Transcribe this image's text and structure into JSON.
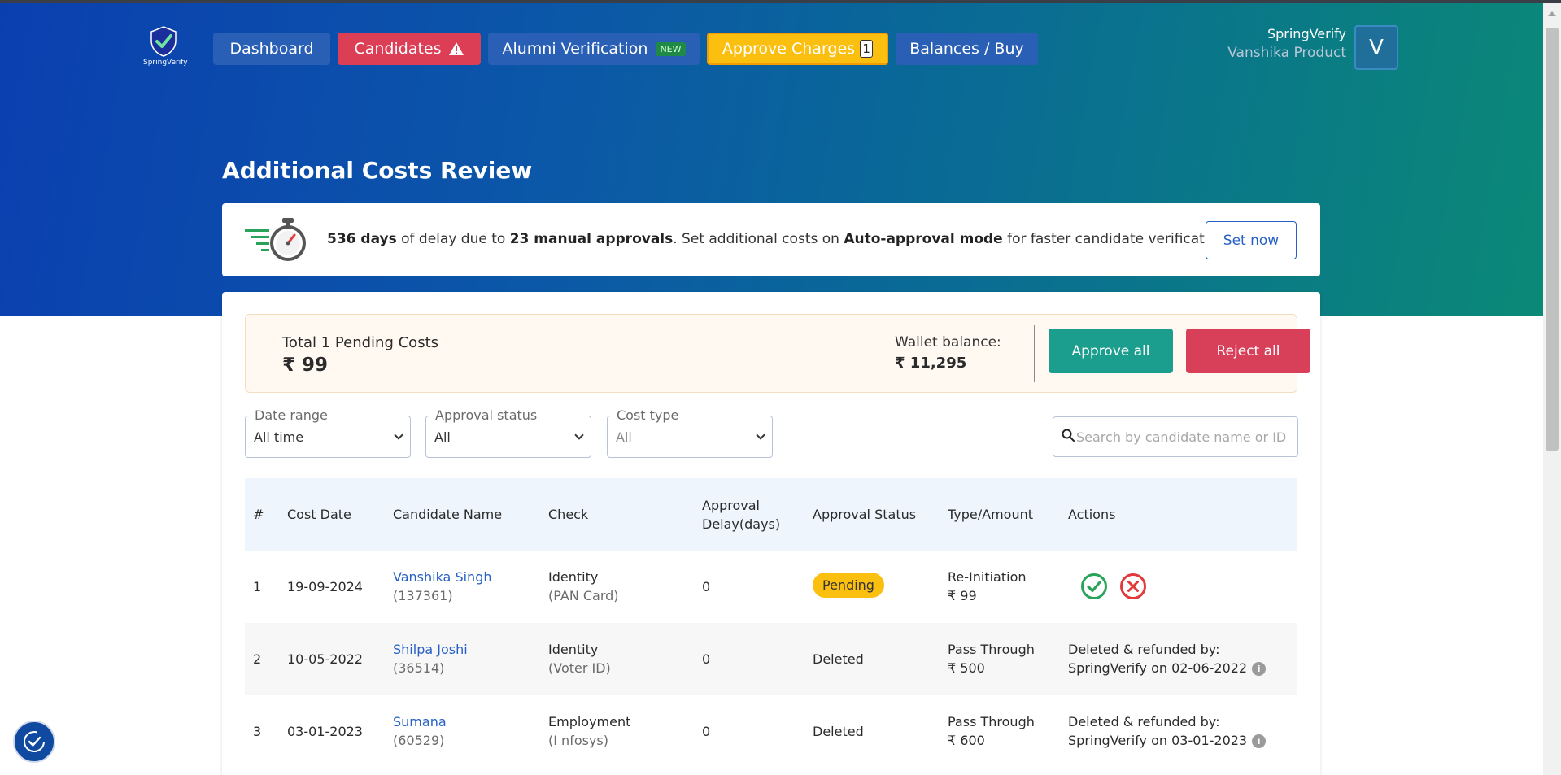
{
  "brand": {
    "logo_text": "SpringVerify"
  },
  "nav": {
    "dashboard": "Dashboard",
    "candidates": "Candidates",
    "alumni": "Alumni Verification",
    "alumni_badge": "NEW",
    "approve_charges": "Approve Charges",
    "approve_count": "1",
    "balances": "Balances / Buy"
  },
  "user": {
    "org": "SpringVerify",
    "name": "Vanshika Product",
    "initial": "V"
  },
  "page": {
    "title": "Additional Costs Review"
  },
  "banner": {
    "days": "536 days",
    "text1": " of delay due to ",
    "approvals": "23 manual approvals",
    "text2": ". Set additional costs on ",
    "mode": "Auto-approval mode",
    "text3": " for faster candidate verification.",
    "button": "Set now"
  },
  "summary": {
    "title": "Total 1 Pending Costs",
    "amount": "₹ 99",
    "wallet_label": "Wallet balance:",
    "wallet_value": "₹ 11,295",
    "approve_all": "Approve all",
    "reject_all": "Reject all"
  },
  "filters": {
    "date_label": "Date range",
    "date_value": "All time",
    "status_label": "Approval status",
    "status_value": "All",
    "cost_label": "Cost type",
    "cost_value": "All",
    "search_placeholder": "Search by candidate name or ID"
  },
  "table": {
    "headers": {
      "num": "#",
      "date": "Cost Date",
      "name": "Candidate Name",
      "check": "Check",
      "delay1": "Approval",
      "delay2": "Delay(days)",
      "status": "Approval Status",
      "type": "Type/Amount",
      "actions": "Actions"
    },
    "rows": [
      {
        "num": "1",
        "date": "19-09-2024",
        "name": "Vanshika Singh",
        "id": "(137361)",
        "check": "Identity",
        "check_sub": "(PAN Card)",
        "delay": "0",
        "status": "Pending",
        "type": "Re-Initiation",
        "amount": "₹ 99"
      },
      {
        "num": "2",
        "date": "10-05-2022",
        "name": "Shilpa Joshi",
        "id": "(36514)",
        "check": "Identity",
        "check_sub": "(Voter ID)",
        "delay": "0",
        "status": "Deleted",
        "type": "Pass Through",
        "amount": "₹ 500",
        "action1": "Deleted & refunded by:",
        "action2": "SpringVerify on 02-06-2022"
      },
      {
        "num": "3",
        "date": "03-01-2023",
        "name": "Sumana",
        "id": "(60529)",
        "check": "Employment",
        "check_sub": "(I nfosys)",
        "delay": "0",
        "status": "Deleted",
        "type": "Pass Through",
        "amount": "₹ 600",
        "action1": "Deleted & refunded by:",
        "action2": "SpringVerify on 03-01-2023"
      }
    ]
  },
  "icons": {
    "warning": "warning-icon",
    "timer": "stopwatch-icon",
    "search": "search-icon",
    "approve": "check-circle-icon",
    "reject": "x-circle-icon",
    "info": "info-icon",
    "help": "help-icon"
  },
  "colors": {
    "primary": "#2660c6",
    "danger": "#d8405a",
    "success": "#1b9e8d",
    "warning": "#fbbf10"
  }
}
